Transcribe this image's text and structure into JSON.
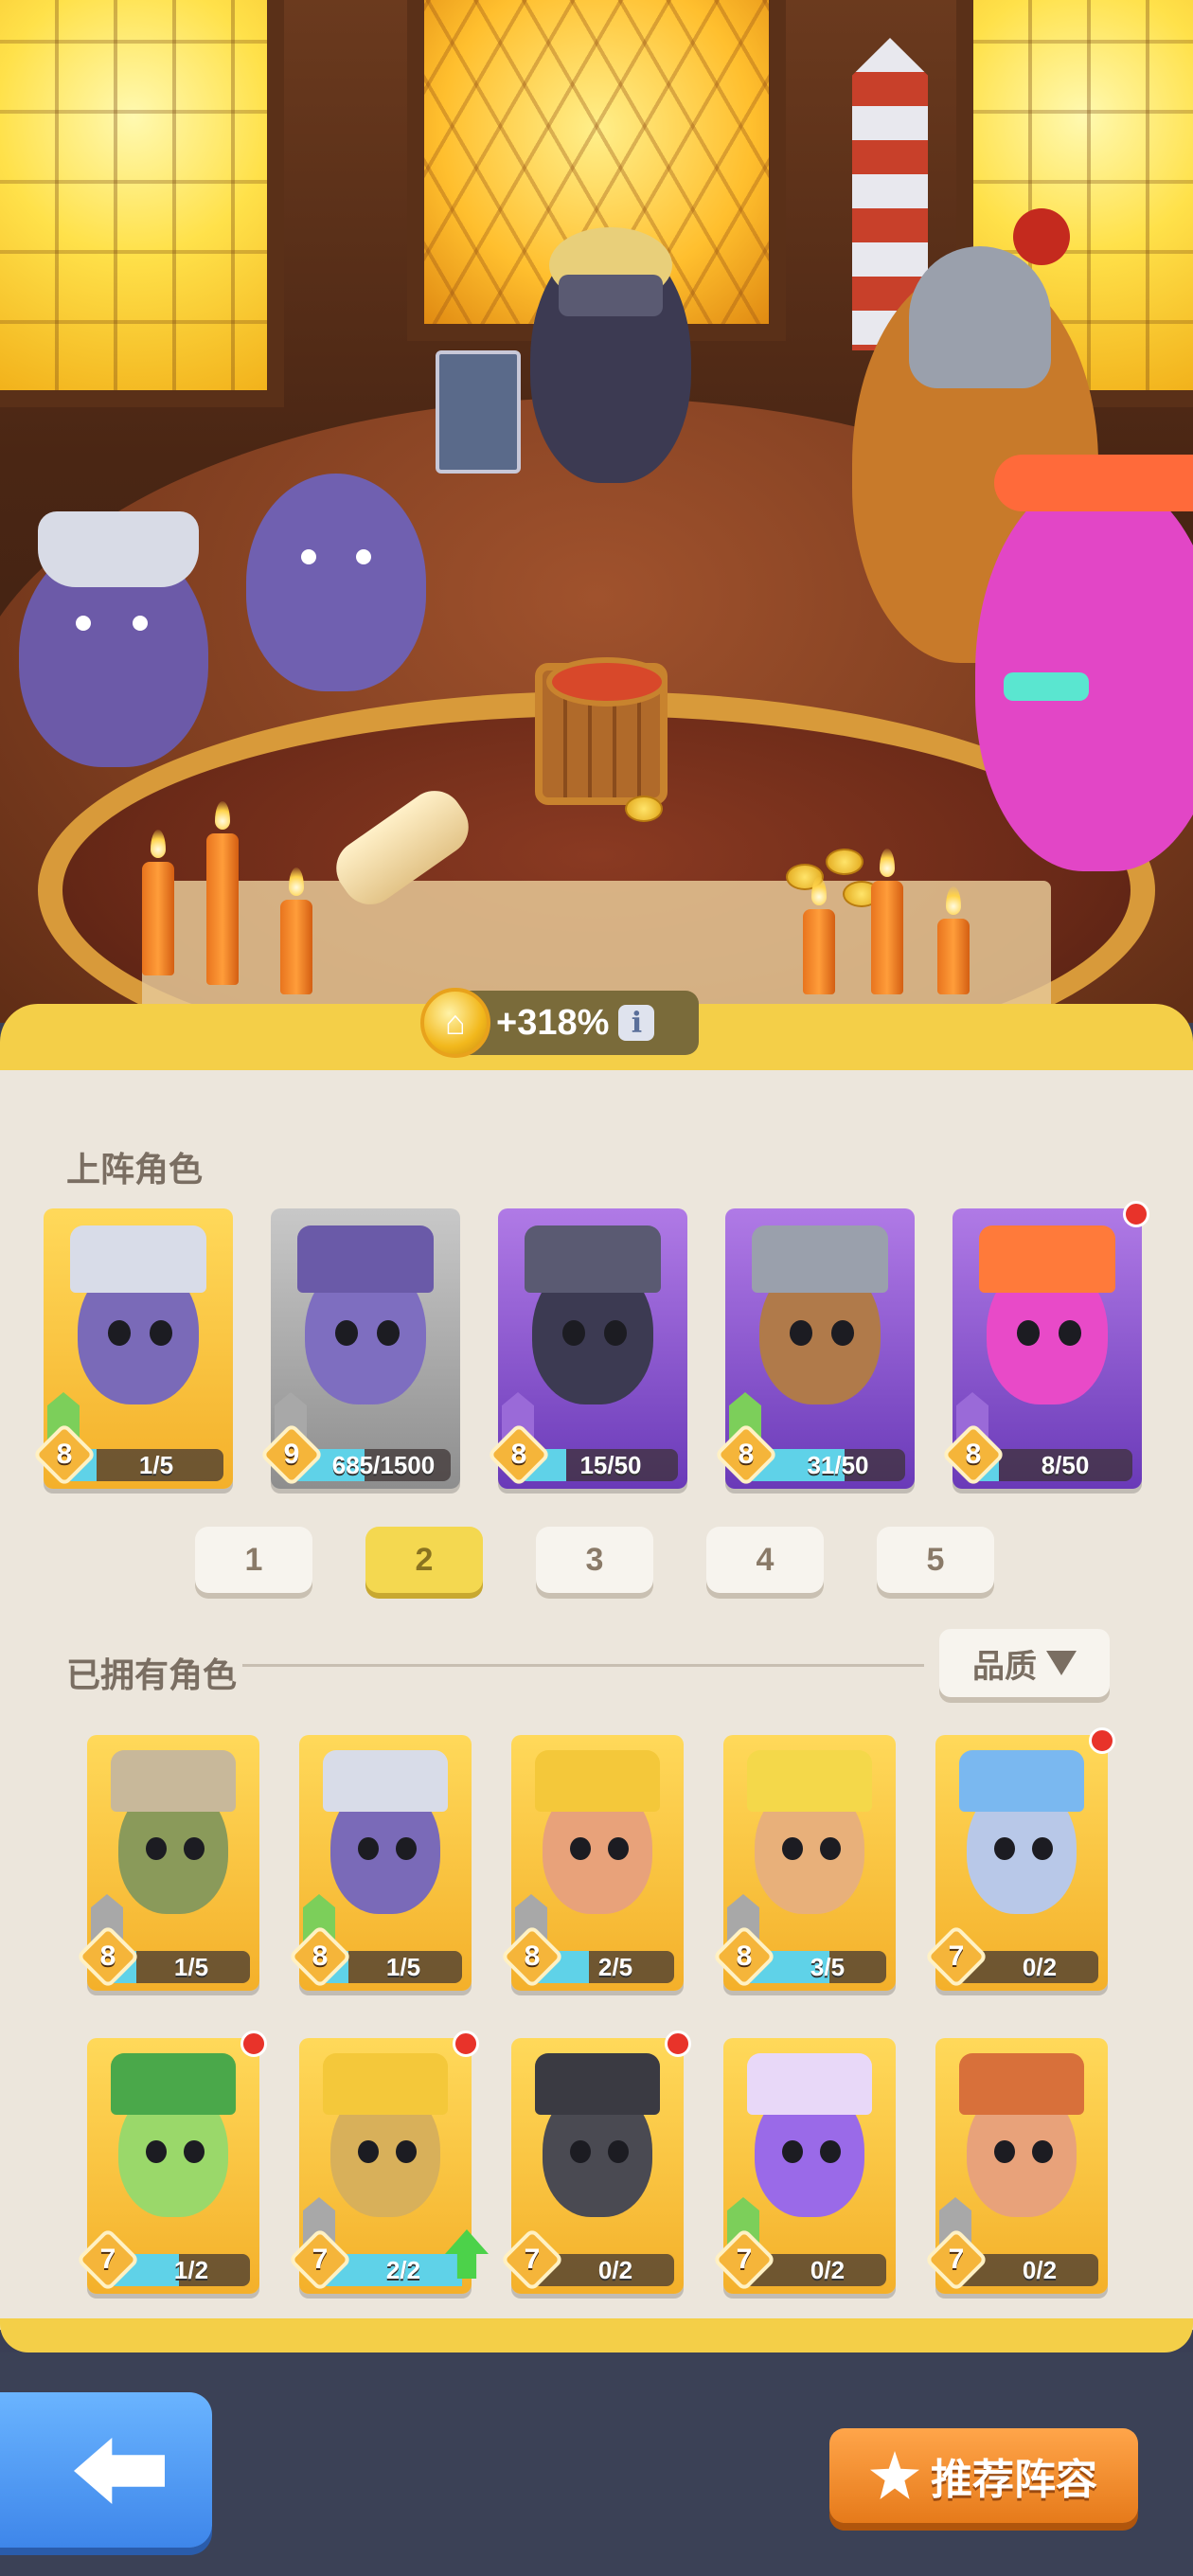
{
  "boost": {
    "value": "+318%",
    "info_glyph": "i"
  },
  "sections": {
    "deployed_title": "上阵角色",
    "owned_title": "已拥有角色"
  },
  "lineup_pages": [
    "1",
    "2",
    "3",
    "4",
    "5"
  ],
  "active_page": "2",
  "sort": {
    "label": "品质"
  },
  "colors": {
    "panel": "#ece6dc",
    "accent_yellow": "#f4cf48",
    "progress": "#5fd2e8",
    "recommend": "#e67a1a",
    "back": "#3e86ea"
  },
  "deployed_heroes": [
    {
      "level": "8",
      "progress": "1/5",
      "fill": 0.2,
      "gem": "green",
      "bg": "yellow",
      "red_dot": false
    },
    {
      "level": "9",
      "progress": "685/1500",
      "fill": 0.46,
      "gem": "gray",
      "bg": "gray",
      "red_dot": false
    },
    {
      "level": "8",
      "progress": "15/50",
      "fill": 0.3,
      "gem": "purple",
      "bg": "purple",
      "red_dot": false
    },
    {
      "level": "8",
      "progress": "31/50",
      "fill": 0.62,
      "gem": "green",
      "bg": "purple",
      "red_dot": false
    },
    {
      "level": "8",
      "progress": "8/50",
      "fill": 0.16,
      "gem": "purple",
      "bg": "purple",
      "red_dot": true
    }
  ],
  "owned_heroes": [
    {
      "level": "8",
      "progress": "1/5",
      "fill": 0.2,
      "gem": "gray",
      "red_dot": false,
      "up": false
    },
    {
      "level": "8",
      "progress": "1/5",
      "fill": 0.2,
      "gem": "green",
      "red_dot": false,
      "up": false
    },
    {
      "level": "8",
      "progress": "2/5",
      "fill": 0.4,
      "gem": "gray",
      "red_dot": false,
      "up": false
    },
    {
      "level": "8",
      "progress": "3/5",
      "fill": 0.6,
      "gem": "gray",
      "red_dot": false,
      "up": false
    },
    {
      "level": "7",
      "progress": "0/2",
      "fill": 0.0,
      "gem": "none",
      "red_dot": true,
      "up": false
    },
    {
      "level": "7",
      "progress": "1/2",
      "fill": 0.5,
      "gem": "none",
      "red_dot": true,
      "up": false
    },
    {
      "level": "7",
      "progress": "2/2",
      "fill": 1.0,
      "gem": "gray",
      "red_dot": true,
      "up": true
    },
    {
      "level": "7",
      "progress": "0/2",
      "fill": 0.0,
      "gem": "none",
      "red_dot": true,
      "up": false
    },
    {
      "level": "7",
      "progress": "0/2",
      "fill": 0.0,
      "gem": "green",
      "red_dot": false,
      "up": false
    },
    {
      "level": "7",
      "progress": "0/2",
      "fill": 0.0,
      "gem": "gray",
      "red_dot": false,
      "up": false
    }
  ],
  "recommend_label": "推荐阵容"
}
